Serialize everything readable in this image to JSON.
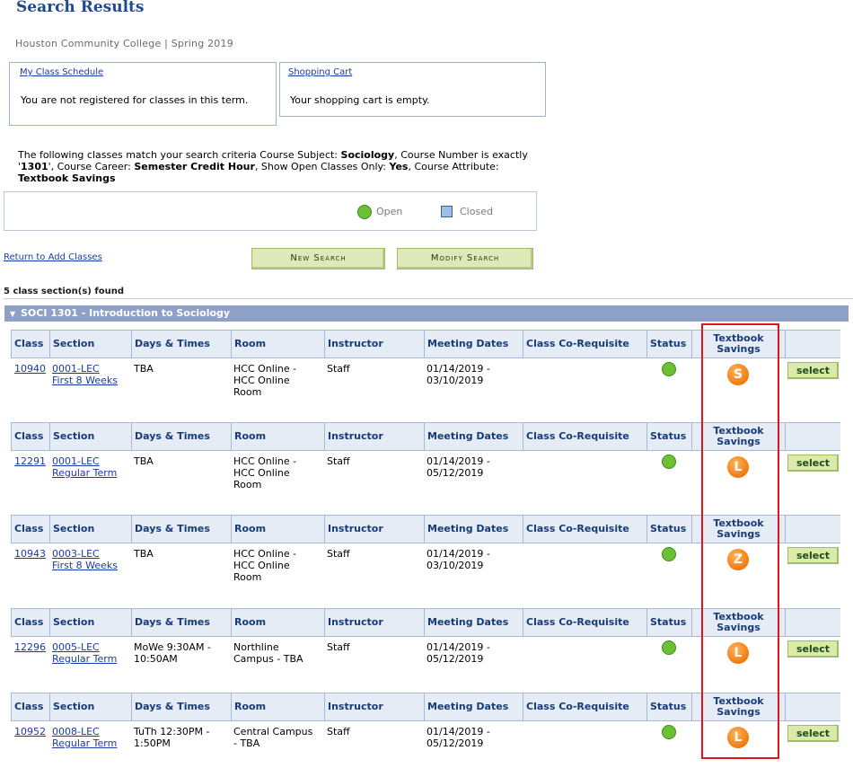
{
  "page": {
    "title": "Search Results",
    "term": "Houston Community College | Spring 2019"
  },
  "schedule_box": {
    "link": "My Class Schedule",
    "message": "You are not registered for classes in this term."
  },
  "cart_box": {
    "link": "Shopping Cart",
    "message": "Your shopping cart is empty."
  },
  "criteria": {
    "intro": "The following classes match your search criteria Course Subject: ",
    "subject": "Sociology",
    "t2": ",  Course Number is exactly '",
    "number": "1301",
    "t3": "',  Course Career: ",
    "career": "Semester Credit Hour",
    "t4": ",  Show Open Classes Only: ",
    "open_only": "Yes",
    "t5": ",  Course Attribute: ",
    "attribute": "Textbook Savings"
  },
  "legend": {
    "open": "Open",
    "closed": "Closed"
  },
  "actions": {
    "return_link": "Return to Add Classes",
    "new_search": "New Search",
    "modify_search": "Modify Search"
  },
  "found": "5 class section(s) found",
  "course_title": "SOCI 1301 - Introduction to Sociology",
  "columns": {
    "class": "Class",
    "section": "Section",
    "days_times": "Days & Times",
    "room": "Room",
    "instructor": "Instructor",
    "meeting_dates": "Meeting Dates",
    "coreq": "Class Co-Requisite",
    "status": "Status",
    "textbook_line1": "Textbook",
    "textbook_line2": "Savings"
  },
  "select_label": "select",
  "sections": [
    {
      "class_nbr": "10940",
      "section": "0001-LEC",
      "session": "First 8 Weeks",
      "days_1": "TBA",
      "days_2": "",
      "room_1": "HCC Online -",
      "room_2": "HCC Online",
      "room_3": "Room",
      "instructor": "Staff",
      "dates_1": "01/14/2019 -",
      "dates_2": "03/10/2019",
      "status": "Open",
      "textbook_code": "S"
    },
    {
      "class_nbr": "12291",
      "section": "0001-LEC",
      "session": "Regular Term",
      "days_1": "TBA",
      "days_2": "",
      "room_1": "HCC Online -",
      "room_2": "HCC Online",
      "room_3": "Room",
      "instructor": "Staff",
      "dates_1": "01/14/2019 -",
      "dates_2": "05/12/2019",
      "status": "Open",
      "textbook_code": "L"
    },
    {
      "class_nbr": "10943",
      "section": "0003-LEC",
      "session": "First 8 Weeks",
      "days_1": "TBA",
      "days_2": "",
      "room_1": "HCC Online -",
      "room_2": "HCC Online",
      "room_3": "Room",
      "instructor": "Staff",
      "dates_1": "01/14/2019 -",
      "dates_2": "03/10/2019",
      "status": "Open",
      "textbook_code": "Z"
    },
    {
      "class_nbr": "12296",
      "section": "0005-LEC",
      "session": "Regular Term",
      "days_1": "MoWe 9:30AM -",
      "days_2": "10:50AM",
      "room_1": "Northline",
      "room_2": "Campus - TBA",
      "room_3": "",
      "instructor": "Staff",
      "dates_1": "01/14/2019 -",
      "dates_2": "05/12/2019",
      "status": "Open",
      "textbook_code": "L"
    },
    {
      "class_nbr": "10952",
      "section": "0008-LEC",
      "session": "Regular Term",
      "days_1": "TuTh 12:30PM -",
      "days_2": "1:50PM",
      "room_1": "Central Campus",
      "room_2": "- TBA",
      "room_3": "",
      "instructor": "Staff",
      "dates_1": "01/14/2019 -",
      "dates_2": "05/12/2019",
      "status": "Open",
      "textbook_code": "L"
    }
  ]
}
